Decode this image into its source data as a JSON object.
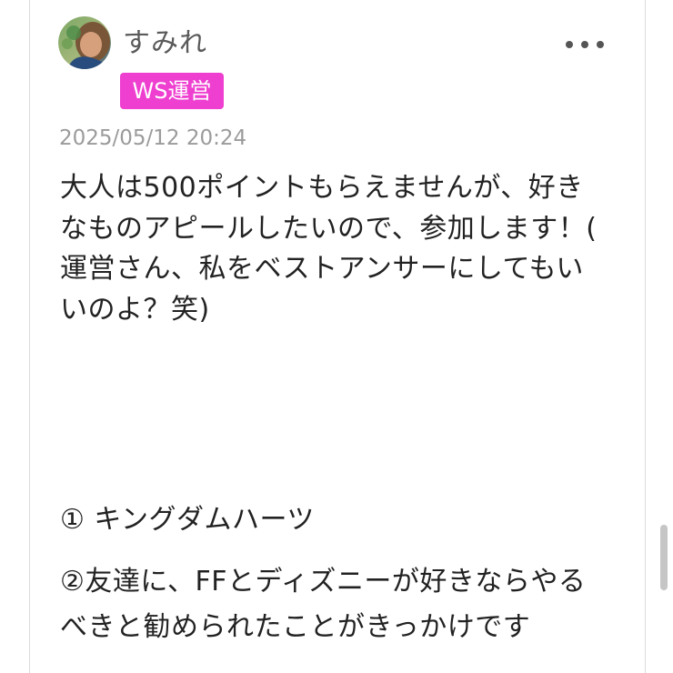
{
  "post": {
    "author": {
      "name": "すみれ",
      "badge": "WS運営",
      "avatar": "avatar-photo"
    },
    "timestamp": "2025/05/12 20:24",
    "body": "大人は500ポイントもらえませんが、好き\nなものアピールしたいので、参加します！(\n運営さん、私をベストアンサーにしてもい\nいのよ？笑)",
    "answers": [
      "① キングダムハーツ",
      "②友達に、FFとディズニーが好きならやる\nべきと勧められたことがきっかけです"
    ]
  },
  "icons": {
    "more": "more-horizontal-icon"
  },
  "colors": {
    "badge_background": "#ee3fd0",
    "text": "#222222",
    "muted_text": "#9b9b9b",
    "border": "#dcdcdc"
  }
}
